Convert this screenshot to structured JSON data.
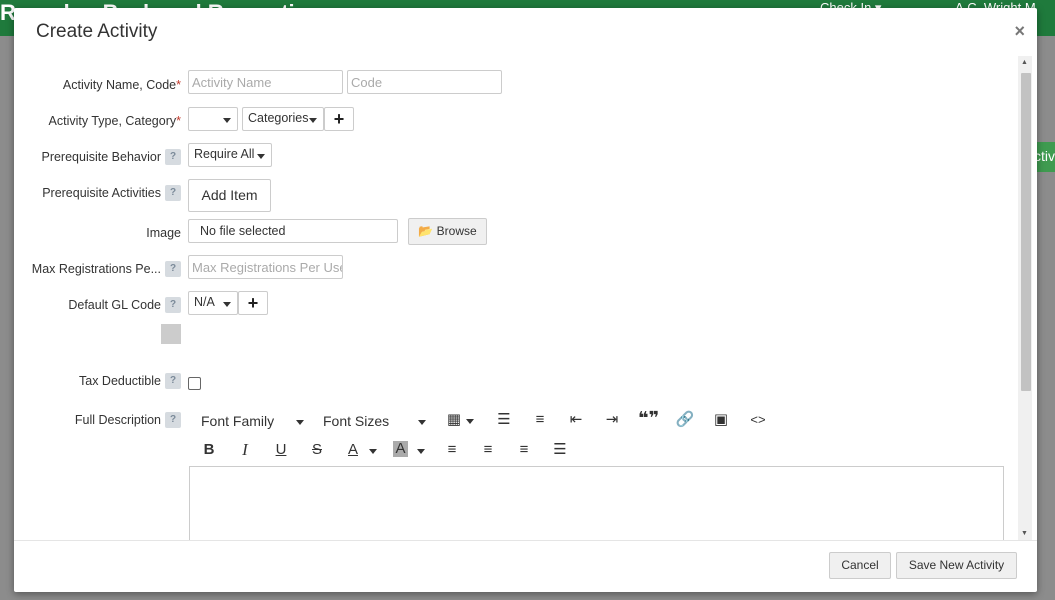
{
  "background": {
    "app_title": "Roundup  Backyard  Recreation  ▾",
    "check_in": "Check In ▾",
    "user": "A.C. Wright M"
  },
  "modal": {
    "title": "Create Activity",
    "close_glyph": "×"
  },
  "form": {
    "activity_name_label": "Activity Name, Code",
    "activity_name_placeholder": "Activity Name",
    "code_placeholder": "Code",
    "activity_type_label": "Activity Type, Category",
    "activity_type_value": "",
    "category_value": "Categories",
    "prereq_behavior_label": "Prerequisite Behavior",
    "prereq_behavior_value": "Require All",
    "prereq_activities_label": "Prerequisite Activities",
    "add_item_label": "Add Item",
    "image_label": "Image",
    "image_file_text": "No file selected",
    "browse_label": "Browse",
    "max_reg_label": "Max Registrations Pe...",
    "max_reg_placeholder": "Max Registrations Per User",
    "gl_code_label": "Default GL Code",
    "gl_code_value": "N/A",
    "tax_deductible_label": "Tax Deductible",
    "full_description_label": "Full Description",
    "help_glyph": "?",
    "required_mark": "*",
    "plus_glyph": "+"
  },
  "editor": {
    "font_family": "Font Family",
    "font_sizes": "Font Sizes",
    "icons": [
      "table-icon",
      "unordered-list-icon",
      "ordered-list-icon",
      "outdent-icon",
      "indent-icon",
      "quote-icon",
      "link-icon",
      "image-icon",
      "code-icon",
      "bold-icon",
      "italic-icon",
      "underline-icon",
      "strikethrough-icon",
      "text-color-icon",
      "background-color-icon",
      "align-left-icon",
      "align-center-icon",
      "align-right-icon",
      "justify-icon"
    ],
    "bold": "B",
    "italic": "I",
    "underline": "U",
    "strike": "S",
    "text_color": "A",
    "bg_color": "A",
    "quote": "❝❞",
    "code": "<>"
  },
  "footer": {
    "cancel_label": "Cancel",
    "save_label": "Save New Activity"
  },
  "colors": {
    "brand_green": "#1f7a3c",
    "required_red": "#c0392b",
    "help_bg": "#d6dbe0"
  }
}
